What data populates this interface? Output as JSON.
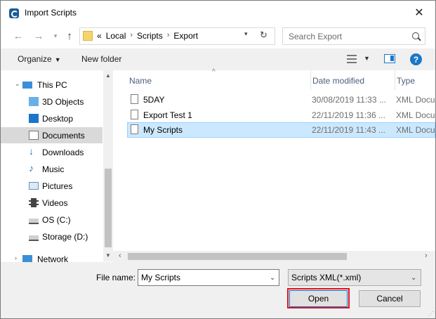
{
  "window": {
    "title": "Import Scripts",
    "close_glyph": "✕"
  },
  "address_bar": {
    "crumbs": [
      "«",
      "Local",
      "Scripts",
      "Export"
    ],
    "separator": "›"
  },
  "search": {
    "placeholder": "Search Export"
  },
  "toolbar": {
    "organize": "Organize",
    "new_folder": "New folder"
  },
  "nav": {
    "items": [
      {
        "label": "This PC",
        "icon": "this-pc-icon"
      },
      {
        "label": "3D Objects",
        "icon": "3d-objects-icon"
      },
      {
        "label": "Desktop",
        "icon": "desktop-icon"
      },
      {
        "label": "Documents",
        "icon": "documents-icon",
        "selected": true
      },
      {
        "label": "Downloads",
        "icon": "downloads-icon"
      },
      {
        "label": "Music",
        "icon": "music-icon"
      },
      {
        "label": "Pictures",
        "icon": "pictures-icon"
      },
      {
        "label": "Videos",
        "icon": "videos-icon"
      },
      {
        "label": "OS (C:)",
        "icon": "drive-icon"
      },
      {
        "label": "Storage (D:)",
        "icon": "drive-icon"
      },
      {
        "label": "Network",
        "icon": "network-icon"
      }
    ]
  },
  "columns": {
    "name": "Name",
    "date": "Date modified",
    "type": "Type"
  },
  "files": [
    {
      "name": "5DAY",
      "date": "30/08/2019 11:33 ...",
      "type": "XML Docu"
    },
    {
      "name": "Export Test 1",
      "date": "22/11/2019 11:36 ...",
      "type": "XML Docu"
    },
    {
      "name": "My Scripts",
      "date": "22/11/2019 11:43 ...",
      "type": "XML Docu",
      "selected": true
    }
  ],
  "footer": {
    "file_name_label": "File name:",
    "file_name_value": "My Scripts",
    "file_type": "Scripts XML(*.xml)",
    "open_label": "Open",
    "cancel_label": "Cancel"
  },
  "colors": {
    "accent": "#0078d7",
    "selection": "#cce8ff",
    "highlight_box": "#e0141e"
  }
}
